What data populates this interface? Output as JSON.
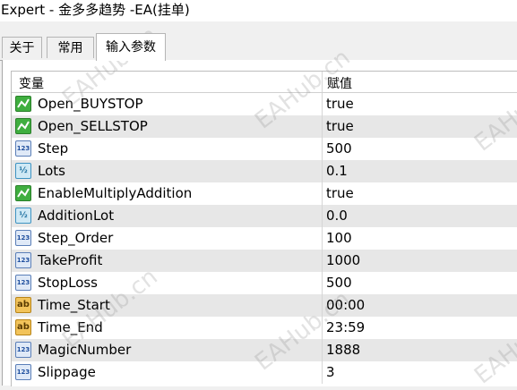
{
  "window": {
    "title": "Expert - 金多多趋势 -EA(挂单)"
  },
  "tabs": [
    {
      "label": "关于"
    },
    {
      "label": "常用"
    },
    {
      "label": "输入参数"
    }
  ],
  "table": {
    "headers": {
      "variable": "变量",
      "value": "赋值"
    },
    "rows": [
      {
        "icon": "bool-icon",
        "icon_text": "",
        "name": "Open_BUYSTOP",
        "value": "true"
      },
      {
        "icon": "bool-icon",
        "icon_text": "",
        "name": "Open_SELLSTOP",
        "value": "true"
      },
      {
        "icon": "int-icon",
        "icon_text": "123",
        "name": "Step",
        "value": "500"
      },
      {
        "icon": "double-icon",
        "icon_text": "½",
        "name": "Lots",
        "value": "0.1"
      },
      {
        "icon": "bool-icon",
        "icon_text": "",
        "name": "EnableMultiplyAddition",
        "value": "true"
      },
      {
        "icon": "double-icon",
        "icon_text": "½",
        "name": "AdditionLot",
        "value": "0.0"
      },
      {
        "icon": "int-icon",
        "icon_text": "123",
        "name": "Step_Order",
        "value": "100"
      },
      {
        "icon": "int-icon",
        "icon_text": "123",
        "name": "TakeProfit",
        "value": "1000"
      },
      {
        "icon": "int-icon",
        "icon_text": "123",
        "name": "StopLoss",
        "value": "500"
      },
      {
        "icon": "string-icon",
        "icon_text": "ab",
        "name": "Time_Start",
        "value": "00:00"
      },
      {
        "icon": "string-icon",
        "icon_text": "ab",
        "name": "Time_End",
        "value": "23:59"
      },
      {
        "icon": "int-icon",
        "icon_text": "123",
        "name": "MagicNumber",
        "value": "1888"
      },
      {
        "icon": "int-icon",
        "icon_text": "123",
        "name": "Slippage",
        "value": "3"
      }
    ]
  },
  "watermark": {
    "text": "EAHub.cn"
  },
  "colors": {
    "row_alt": "#e7e7e7",
    "bool_icon": "#3fae3f",
    "string_icon": "#f2c35a"
  }
}
